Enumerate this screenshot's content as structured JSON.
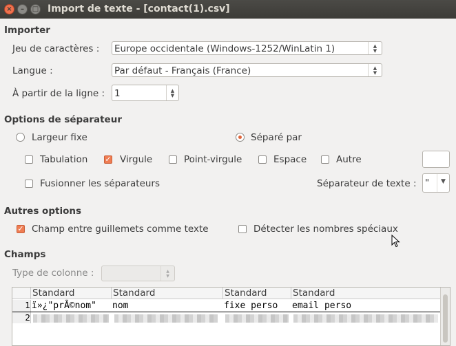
{
  "window": {
    "title": "Import de texte - [contact(1).csv]"
  },
  "importer": {
    "section": "Importer",
    "charset_label": "Jeu de caractères :",
    "charset_value": "Europe occidentale (Windows-1252/WinLatin 1)",
    "language_label": "Langue :",
    "language_value": "Par défaut - Français (France)",
    "from_line_label": "À partir de la ligne :",
    "from_line_value": "1"
  },
  "separator": {
    "section": "Options de séparateur",
    "fixed_width": "Largeur fixe",
    "separated_by": "Séparé par",
    "tab": "Tabulation",
    "comma": "Virgule",
    "semicolon": "Point-virgule",
    "space": "Espace",
    "other": "Autre",
    "merge": "Fusionner les séparateurs",
    "text_sep_label": "Séparateur de texte :",
    "text_sep_value": "\""
  },
  "other_options": {
    "section": "Autres options",
    "quoted_as_text": "Champ entre guillemets comme texte",
    "detect_special": "Détecter les nombres spéciaux"
  },
  "fields": {
    "section": "Champs",
    "column_type_label": "Type de colonne :",
    "headers": [
      "Standard",
      "Standard",
      "Standard",
      "Standard"
    ],
    "rows": [
      {
        "num": "1",
        "cells": [
          "ï»¿\"prÃ©nom\"",
          "nom",
          "fixe perso",
          "email perso"
        ]
      },
      {
        "num": "2",
        "cells": [
          "",
          "",
          "",
          ""
        ]
      }
    ]
  }
}
